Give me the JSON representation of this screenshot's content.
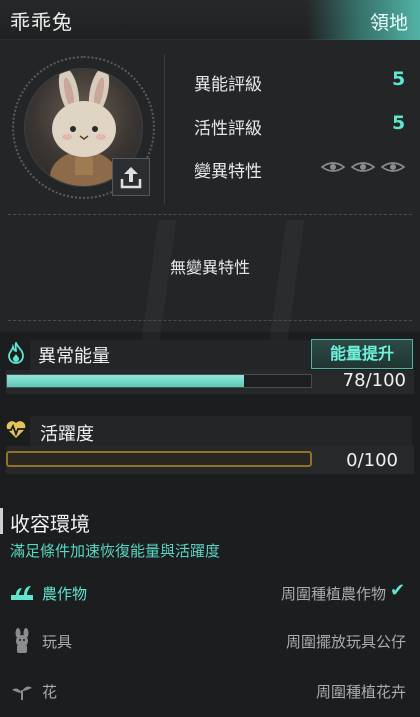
{
  "header": {
    "title": "乖乖兔",
    "territory_button": "領地"
  },
  "stats": {
    "anomaly_rating_label": "異能評級",
    "anomaly_rating_value": "5",
    "activity_rating_label": "活性評級",
    "activity_rating_value": "5",
    "mutation_trait_label": "變異特性",
    "no_mutation_text": "無變異特性"
  },
  "energy": {
    "label": "異常能量",
    "boost_button": "能量提升",
    "current": 78,
    "max": 100,
    "value_text": "78/100"
  },
  "activity": {
    "label": "活躍度",
    "current": 0,
    "max": 100,
    "value_text": "0/100"
  },
  "containment": {
    "title": "收容環境",
    "subtitle": "滿足條件加速恢復能量與活躍度",
    "items": [
      {
        "name": "農作物",
        "condition": "周圍種植農作物",
        "icon": "crop-icon",
        "met": true
      },
      {
        "name": "玩具",
        "condition": "周圍擺放玩具公仔",
        "icon": "toy-icon",
        "met": false
      },
      {
        "name": "花",
        "condition": "周圍種植花卉",
        "icon": "flower-icon",
        "met": false
      }
    ]
  },
  "colors": {
    "accent": "#5ee6cf",
    "activity_border": "#8d7428",
    "background": "#1b1d1f"
  }
}
